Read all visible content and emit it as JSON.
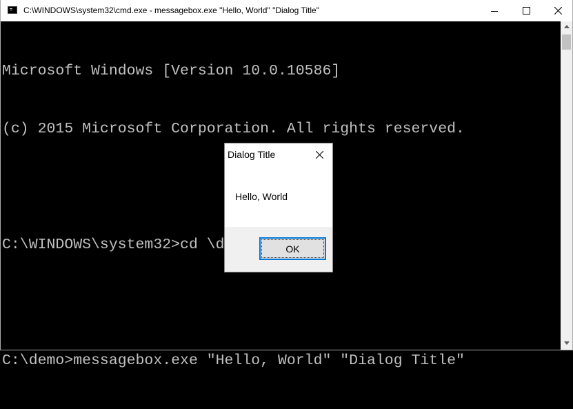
{
  "window": {
    "title": "C:\\WINDOWS\\system32\\cmd.exe - messagebox.exe  \"Hello, World\" \"Dialog Title\"",
    "controls": {
      "minimize": "minimize-icon",
      "maximize": "maximize-icon",
      "close": "close-icon"
    }
  },
  "console": {
    "lines": [
      "Microsoft Windows [Version 10.0.10586]",
      "(c) 2015 Microsoft Corporation. All rights reserved.",
      "",
      "C:\\WINDOWS\\system32>cd \\demo",
      "",
      "C:\\demo>messagebox.exe \"Hello, World\" \"Dialog Title\""
    ],
    "text_color": "#c0c0c0",
    "background": "#000000"
  },
  "dialog": {
    "title": "Dialog Title",
    "message": "Hello, World",
    "ok_label": "OK",
    "accent": "#0078d7"
  }
}
